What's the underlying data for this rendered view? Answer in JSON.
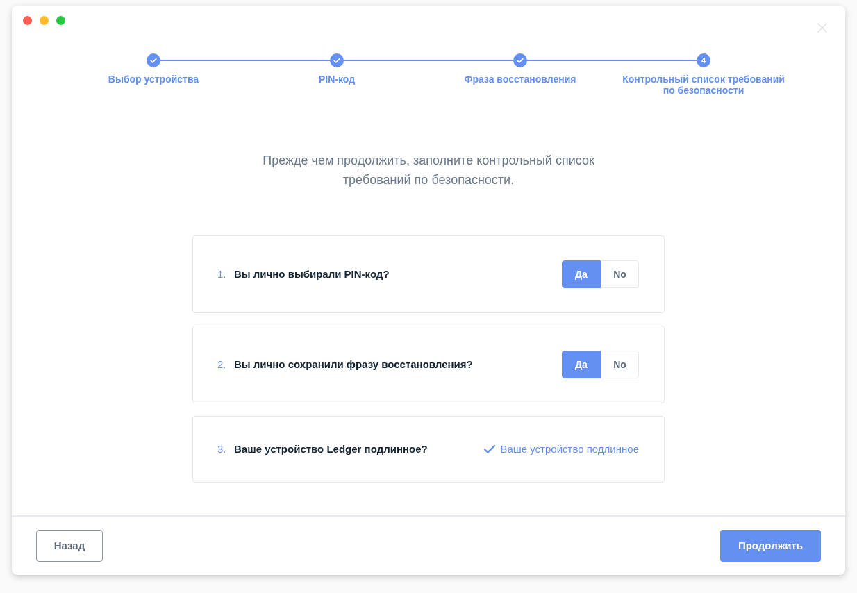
{
  "stepper": {
    "steps": [
      {
        "label": "Выбор устройства",
        "completed": true,
        "current": false
      },
      {
        "label": "PIN-код",
        "completed": true,
        "current": false
      },
      {
        "label": "Фраза восстановления",
        "completed": true,
        "current": false
      },
      {
        "label": "Контрольный список требований по безопасности",
        "number": "4",
        "completed": false,
        "current": true
      }
    ]
  },
  "intro": "Прежде чем продолжить, заполните контрольный список требований по безопасности.",
  "checklist": [
    {
      "number": "1.",
      "question": "Вы лично выбирали PIN-код?",
      "kind": "toggle",
      "options": [
        {
          "label": "Да",
          "selected": true
        },
        {
          "label": "No",
          "selected": false
        }
      ]
    },
    {
      "number": "2.",
      "question": "Вы лично сохранили фразу восстановления?",
      "kind": "toggle",
      "options": [
        {
          "label": "Да",
          "selected": true
        },
        {
          "label": "No",
          "selected": false
        }
      ]
    },
    {
      "number": "3.",
      "question": "Ваше устройство Ledger подлинное?",
      "kind": "status",
      "status_text": "Ваше устройство подлинное"
    }
  ],
  "footer": {
    "back_button": "Назад",
    "continue_button": "Продолжить"
  }
}
